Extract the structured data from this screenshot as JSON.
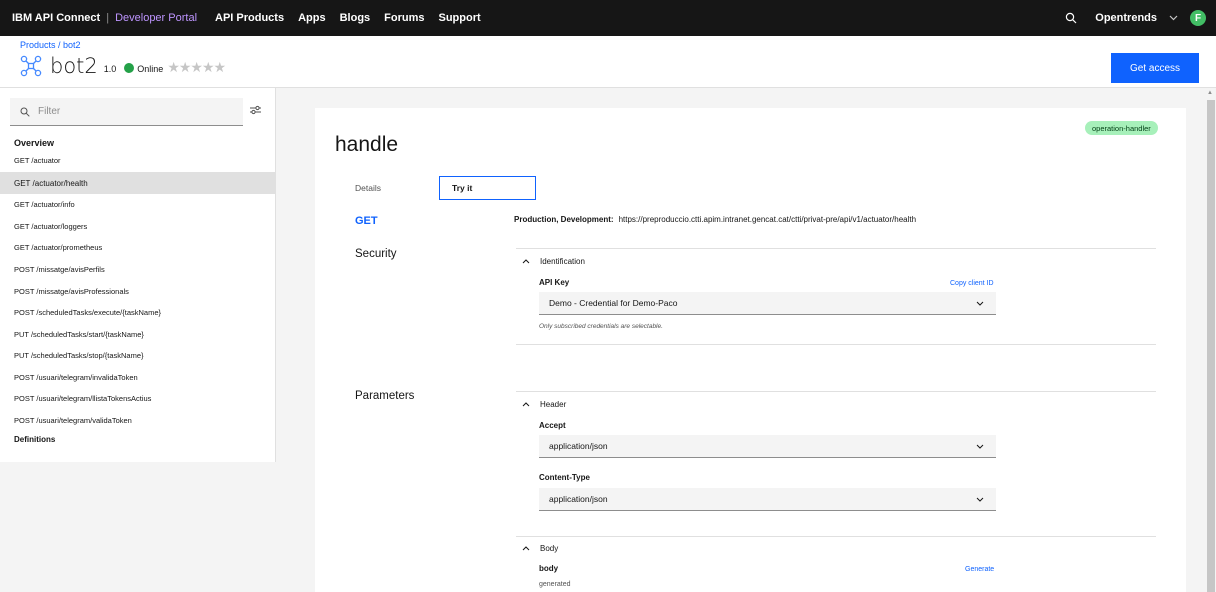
{
  "topnav": {
    "brand": "IBM API Connect",
    "separator": "|",
    "portal": "Developer Portal",
    "links": [
      "API Products",
      "Apps",
      "Blogs",
      "Forums",
      "Support"
    ],
    "user": "Opentrends",
    "avatar_initial": "F"
  },
  "header": {
    "breadcrumb": "Products / bot2",
    "title": "bot2",
    "version": "1.0",
    "status": "Online",
    "rating_stars": "★★★★★",
    "get_access": "Get access"
  },
  "sidebar": {
    "filter_placeholder": "Filter",
    "overview": "Overview",
    "items": [
      "GET /actuator",
      "GET /actuator/health",
      "GET /actuator/info",
      "GET /actuator/loggers",
      "GET /actuator/prometheus",
      "POST /missatge/avisPerfils",
      "POST /missatge/avisProfessionals",
      "POST /scheduledTasks/execute/{taskName}",
      "PUT /scheduledTasks/start/{taskName}",
      "PUT /scheduledTasks/stop/{taskName}",
      "POST /usuari/telegram/invalidaToken",
      "POST /usuari/telegram/llistaTokensActius",
      "POST /usuari/telegram/validaToken"
    ],
    "selected_index": 1,
    "definitions": "Definitions"
  },
  "main": {
    "badge": "operation-handler",
    "title": "handle",
    "tabs": [
      "Details",
      "Try it"
    ],
    "active_tab": "Try it",
    "method": "GET",
    "env_label": "Production, Development:",
    "url": "https://preproduccio.ctti.apim.intranet.gencat.cat/ctti/privat-pre/api/v1/actuator/health",
    "security_label": "Security",
    "identification": "Identification",
    "api_key_label": "API Key",
    "copy_client_id": "Copy client ID",
    "credential_value": "Demo - Credential for Demo-Paco",
    "credential_hint": "Only subscribed credentials are selectable.",
    "parameters_label": "Parameters",
    "header_section": "Header",
    "accept_label": "Accept",
    "accept_value": "application/json",
    "content_type_label": "Content-Type",
    "content_type_value": "application/json",
    "body_section": "Body",
    "body_label": "body",
    "generate": "Generate",
    "body_note": "generated"
  },
  "colors": {
    "nav_bg": "#161616",
    "portal": "#be95ff",
    "accent": "#0f62fe",
    "online": "#24a148",
    "badge_bg": "#a7f0ba",
    "avatar": "#42be65"
  },
  "icons": [
    "search-icon",
    "chevron-down-icon",
    "api-product-icon",
    "filter-settings-icon",
    "chevron-up-icon"
  ]
}
